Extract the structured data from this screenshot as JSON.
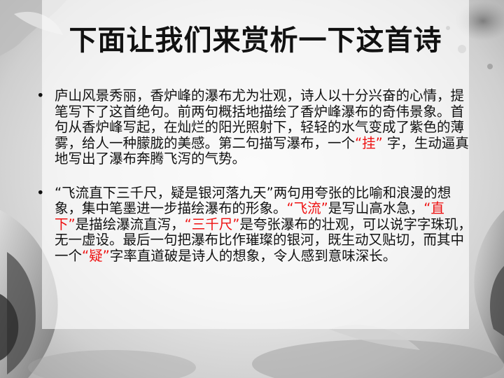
{
  "slide": {
    "title": "下面让我们来赏析一下这首诗",
    "bullets": [
      {
        "segments": [
          {
            "text": "庐山风景秀丽，香炉峰的瀑布尤为壮观，诗人以十分兴奋的心情，提笔写下了这首绝句。前两句概括地描绘了香炉峰瀑布的奇伟景象。首句从香炉峰写起，在灿烂的阳光照射下，轻轻的水气变成了紫色的薄雾，给人一种朦胧的美感。第二句描写瀑布，一个"
          },
          {
            "text": "“挂”",
            "highlight": true
          },
          {
            "text": " 字，生动逼真地写出了瀑布奔腾飞泻的气势。"
          }
        ]
      },
      {
        "segments": [
          {
            "text": "“飞流直下三千尺，疑是银河落九天”两句用夸张的比喻和浪漫的想象，集中笔墨进一步描绘瀑布的形象。"
          },
          {
            "text": "“飞流”",
            "highlight": true
          },
          {
            "text": "是写山高水急，"
          },
          {
            "text": "“直下”",
            "highlight": true
          },
          {
            "text": "是描绘瀑流直泻，"
          },
          {
            "text": "“三千尺”",
            "highlight": true
          },
          {
            "text": "是夸张瀑布的壮观，可以说字字珠玑，无一虚设。最后一句把瀑布比作璀璨的银河，既生动又贴切，而其中一个"
          },
          {
            "text": "“疑”",
            "highlight": true
          },
          {
            "text": "字率直道破是诗人的想象，令人感到意味深长。"
          }
        ]
      }
    ]
  },
  "colors": {
    "highlight": "#ee1111",
    "text": "#111111"
  },
  "decorations": [
    "ink-fish-art",
    "ink-splash-art"
  ]
}
